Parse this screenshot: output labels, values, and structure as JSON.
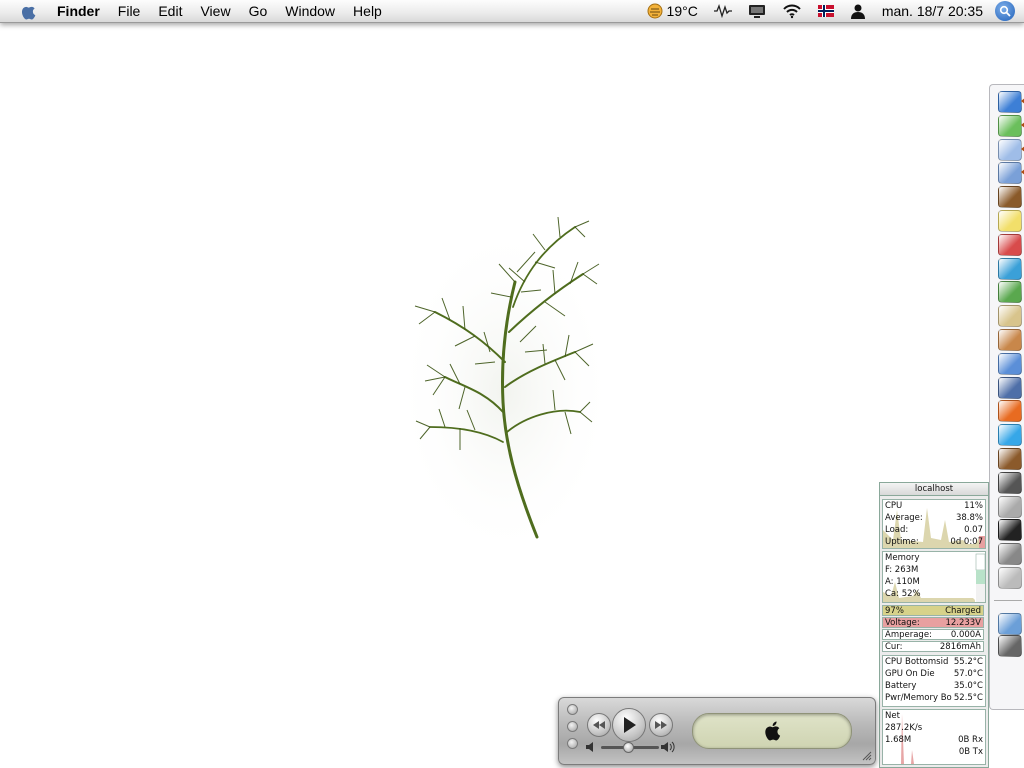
{
  "menubar": {
    "app_name": "Finder",
    "items": [
      "File",
      "Edit",
      "View",
      "Go",
      "Window",
      "Help"
    ],
    "temperature": "19°C",
    "clock": "man. 18/7  20:35"
  },
  "stats": {
    "title": "localhost",
    "cpu": {
      "label": "CPU",
      "value": "11%",
      "average_label": "Average:",
      "average": "38.8%",
      "load_label": "Load:",
      "load": "0.07",
      "uptime_label": "Uptime:",
      "uptime": "0d 0:07"
    },
    "memory": {
      "label": "Memory",
      "free": "F: 263M",
      "active": "A: 110M",
      "cache": "Ca: 52%"
    },
    "battery": {
      "percent": "97%",
      "state": "Charged",
      "voltage_label": "Voltage:",
      "voltage": "12.233V",
      "amperage_label": "Amperage:",
      "amperage": "0.000A",
      "current_label": "Cur:",
      "current": "2816mAh"
    },
    "temps": [
      {
        "label": "CPU Bottomsid",
        "value": "55.2°C"
      },
      {
        "label": "GPU On Die",
        "value": "57.0°C"
      },
      {
        "label": "Battery",
        "value": "35.0°C"
      },
      {
        "label": "Pwr/Memory Bo",
        "value": "52.5°C"
      }
    ],
    "net": {
      "label": "Net",
      "rate": "287.2K/s",
      "total": "1.68M",
      "rx": "0B Rx",
      "tx": "0B Tx"
    }
  },
  "dock_icons": [
    "finder-icon",
    "itunes-icon",
    "safari-icon",
    "preview-icon",
    "address-book-icon",
    "stickies-icon",
    "ical-icon",
    "dashboard-icon",
    "photo-icon",
    "script-icon",
    "iphoto-icon",
    "ichat-icon",
    "network-icon",
    "firefox-icon",
    "messenger-icon",
    "dictionary-icon",
    "sync-icon",
    "disk-utility-icon",
    "terminal-icon",
    "keychain-icon",
    "apple-icon",
    "applications-folder-icon",
    "trash-icon"
  ],
  "colors": {
    "menubar": "#ebebeb",
    "battery_bar": "#d7d28a",
    "voltage_bar": "#e8a0a0",
    "cpu_graph": "#d6cfa0"
  }
}
